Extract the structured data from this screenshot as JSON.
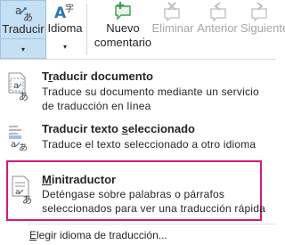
{
  "ribbon": {
    "traducir": {
      "label": "Traducir",
      "caret": "▾"
    },
    "idioma": {
      "label": "Idioma",
      "caret": "▾"
    },
    "nuevo_comentario": {
      "line1": "Nuevo",
      "line2": "comentario"
    },
    "eliminar": {
      "label": "Eliminar"
    },
    "anterior": {
      "label": "Anterior"
    },
    "siguiente": {
      "label": "Siguiente"
    }
  },
  "menu": {
    "items": [
      {
        "title_pre": "T",
        "title_ul": "r",
        "title_post": "aducir documento",
        "desc_line1": "Traduce su documento mediante un servicio",
        "desc_line2": "de traducción en línea",
        "icon": "translate-document-icon"
      },
      {
        "title_pre": "Traducir texto ",
        "title_ul": "s",
        "title_post": "eleccionado",
        "desc_line1": "Traduce el texto seleccionado a otro idioma",
        "icon": "translate-selection-icon"
      },
      {
        "title_pre": "",
        "title_ul": "M",
        "title_post": "initraductor",
        "desc_line1": "Deténgase sobre palabras o párrafos",
        "desc_line2": "seleccionados para ver una traducción rápida",
        "icon": "mini-translator-icon"
      }
    ],
    "footer": {
      "pre": "",
      "ul": "E",
      "post": "legir idioma de traducción..."
    }
  },
  "colors": {
    "selected_bg": "#c5dff3",
    "highlight_border": "#d3197d",
    "accent_blue": "#2e75b6",
    "comment_green": "#3b9f57"
  }
}
